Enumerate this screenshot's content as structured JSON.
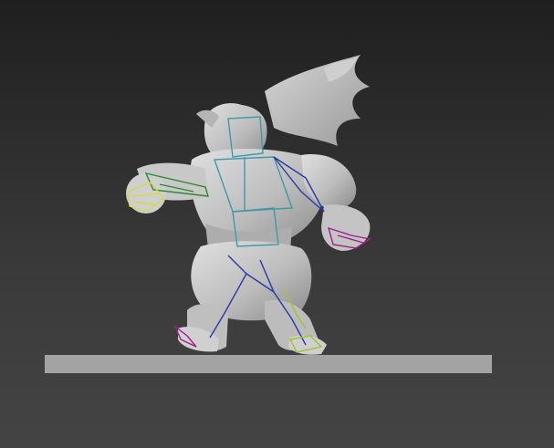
{
  "viewport": {
    "background_top": "#1f1f1f",
    "background_bottom": "#444444"
  },
  "scene": {
    "ground_color": "#a3a3a3",
    "mesh_color": "#c4c4c4",
    "mesh_shadow": "#8f8f8f",
    "rig_colors": {
      "spine": "#3f9aa8",
      "arm_left": "#2d8a2d",
      "hand_left": "#d8d84a",
      "hand_right": "#a0208a",
      "legs": "#2a3aa8",
      "foot_left": "#a0208a",
      "foot_right": "#9ac82a"
    },
    "icons": [
      "character-mesh-icon",
      "bone-rig-icon"
    ]
  }
}
